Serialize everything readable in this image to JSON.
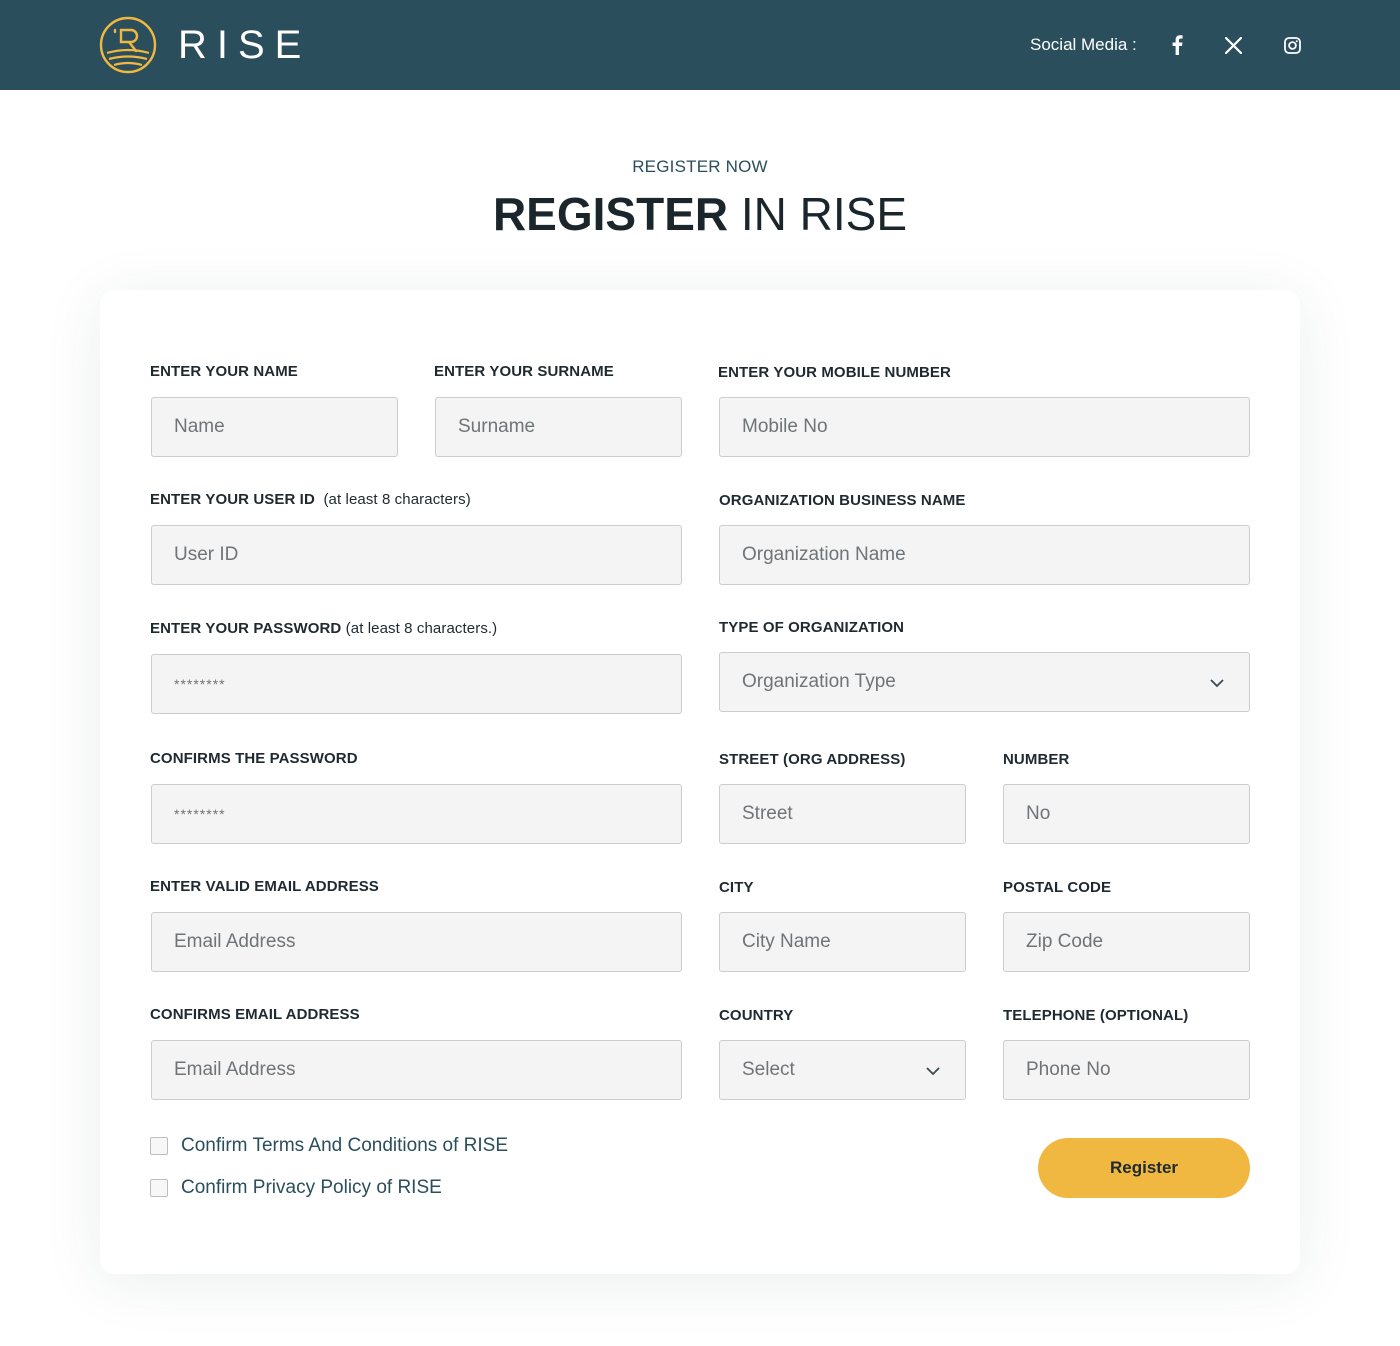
{
  "header": {
    "brand": "RISE",
    "social_label": "Social Media :",
    "social_icons": [
      "facebook-icon",
      "x-icon",
      "instagram-icon"
    ],
    "colors": {
      "header_bg": "#2b4e5c",
      "logo_accent": "#f0b840"
    }
  },
  "intro": {
    "eyebrow": "REGISTER NOW",
    "title_bold": "REGISTER",
    "title_rest": " IN RISE"
  },
  "form": {
    "name": {
      "label": "ENTER YOUR NAME",
      "placeholder": "Name"
    },
    "surname": {
      "label": "ENTER YOUR SURNAME",
      "placeholder": "Surname"
    },
    "mobile": {
      "label": "ENTER YOUR MOBILE NUMBER",
      "placeholder": "Mobile No"
    },
    "user_id": {
      "label": "ENTER YOUR USER ID",
      "note": "(at least 8 characters)",
      "placeholder": "User ID"
    },
    "org_name": {
      "label": "ORGANIZATION BUSINESS NAME",
      "placeholder": "Organization Name"
    },
    "password": {
      "label": "ENTER YOUR PASSWORD",
      "note": "(at least 8 characters.)",
      "placeholder": "********"
    },
    "org_type": {
      "label": "TYPE OF ORGANIZATION",
      "selected": "Organization Type"
    },
    "confirm_password": {
      "label": "CONFIRMS THE PASSWORD",
      "placeholder": "********"
    },
    "street": {
      "label": "STREET (ORG ADDRESS)",
      "placeholder": "Street"
    },
    "number": {
      "label": "NUMBER",
      "placeholder": "No"
    },
    "email": {
      "label": "ENTER VALID EMAIL ADDRESS",
      "placeholder": "Email Address"
    },
    "city": {
      "label": "CITY",
      "placeholder": "City Name"
    },
    "postal_code": {
      "label": "POSTAL CODE",
      "placeholder": "Zip Code"
    },
    "confirm_email": {
      "label": "CONFIRMS EMAIL ADDRESS",
      "placeholder": "Email Address"
    },
    "country": {
      "label": "COUNTRY",
      "selected": "Select"
    },
    "telephone": {
      "label": "TELEPHONE (OPTIONAL)",
      "placeholder": "Phone No"
    },
    "terms_label": "Confirm Terms And Conditions of RISE",
    "privacy_label": "Confirm Privacy Policy of RISE",
    "register_label": "Register",
    "colors": {
      "button": "#f0b840",
      "input_bg": "#f4f4f4"
    }
  }
}
